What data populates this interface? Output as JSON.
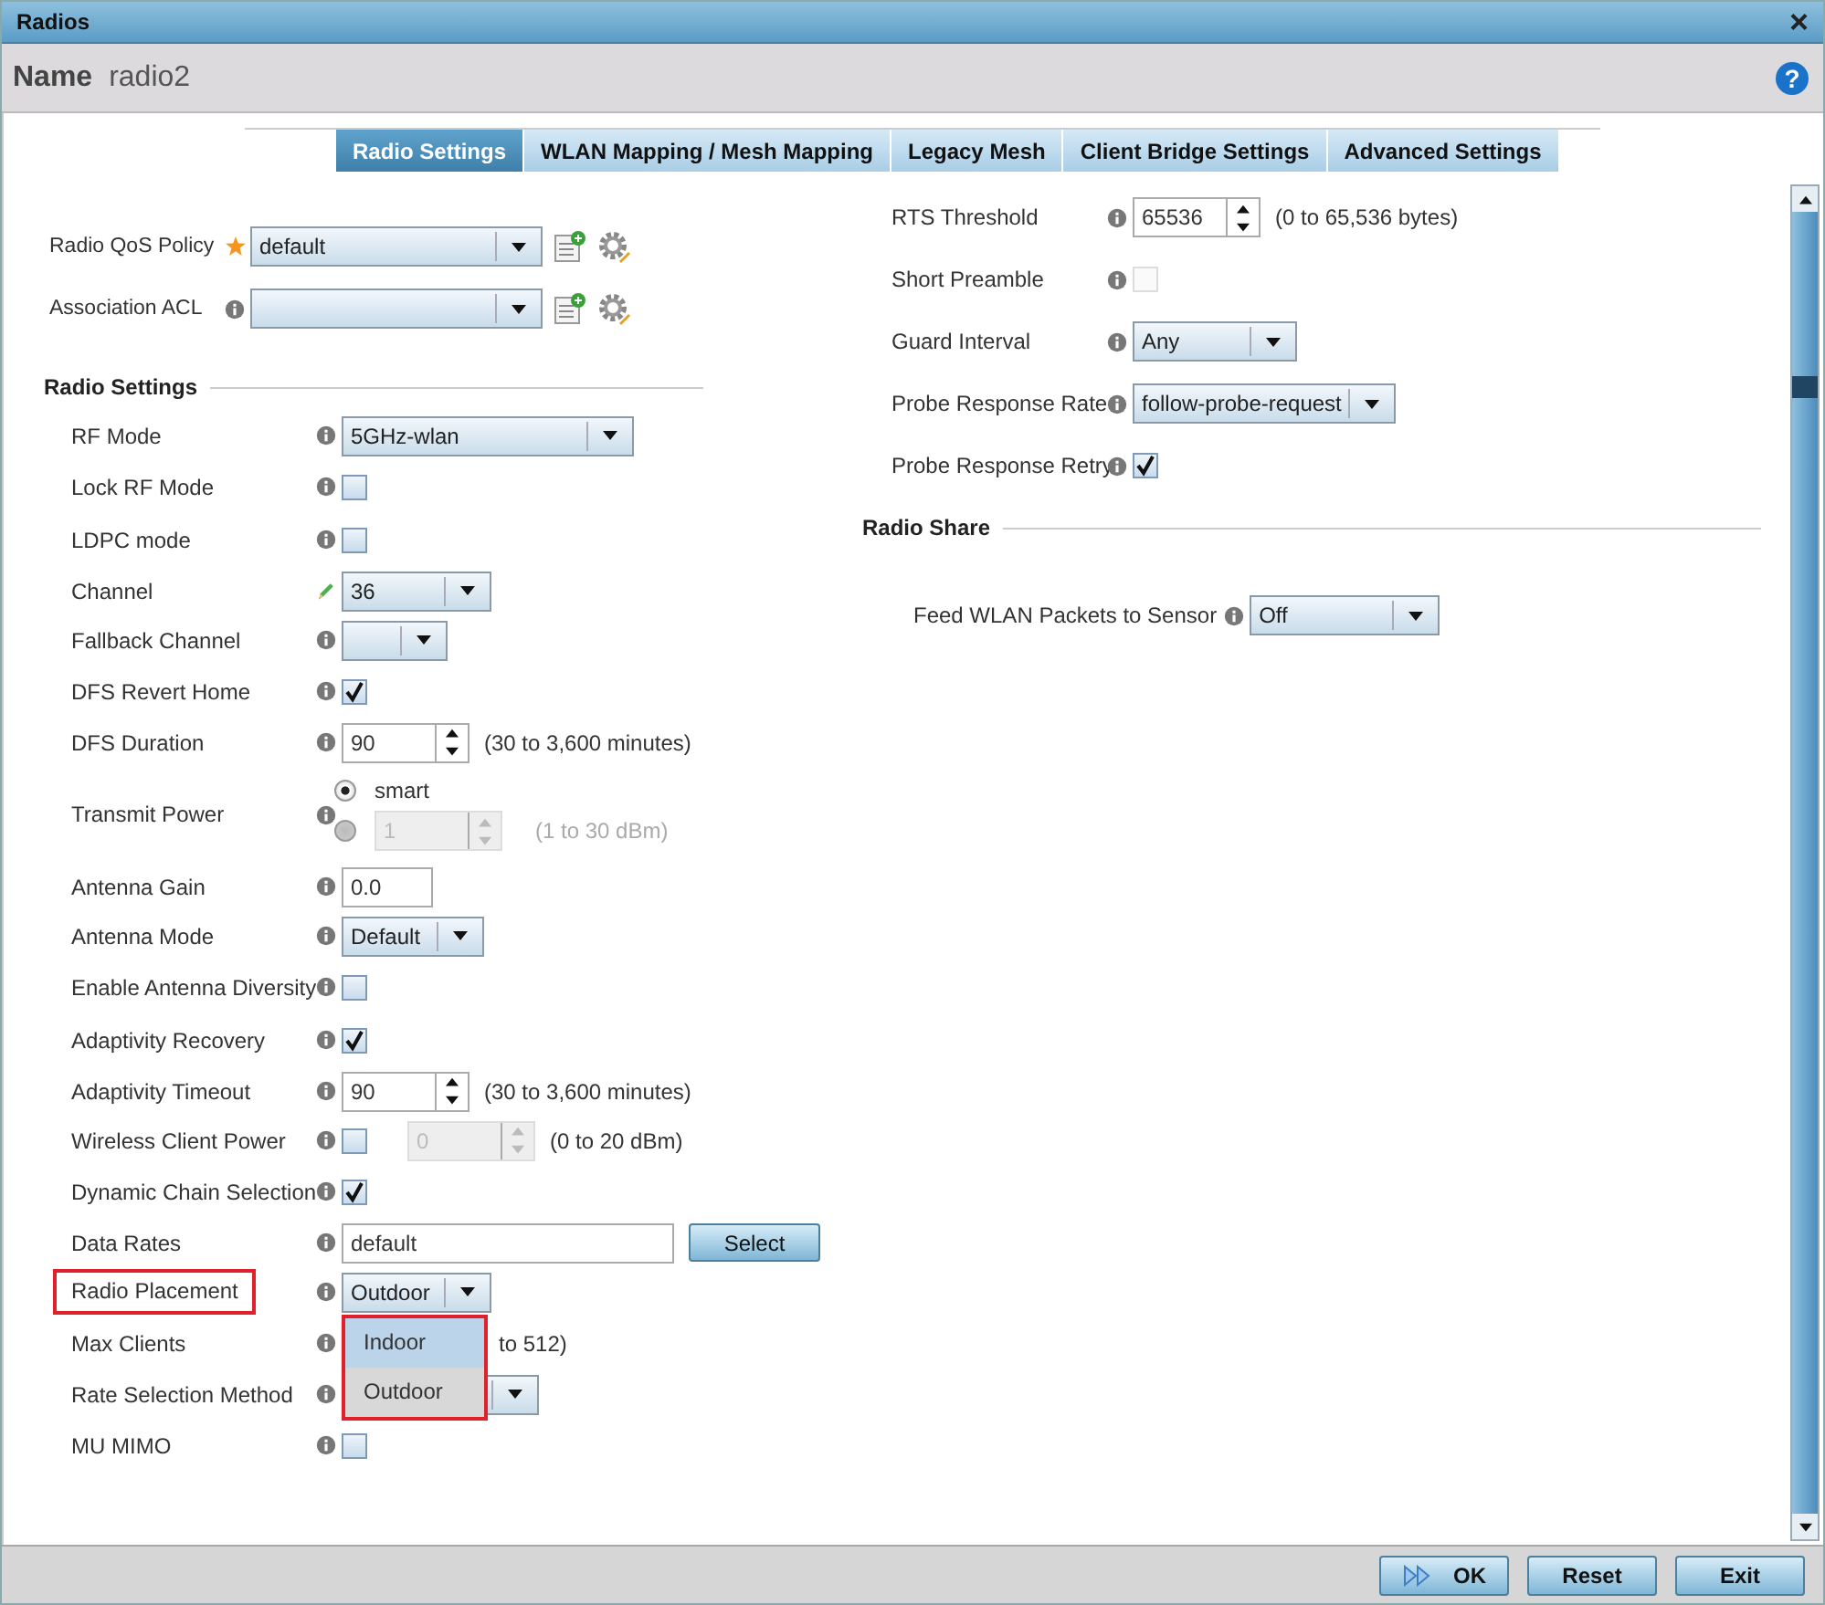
{
  "window": {
    "title": "Radios",
    "close": "×"
  },
  "name_bar": {
    "label": "Name",
    "value": "radio2",
    "help": "?"
  },
  "tabs": [
    {
      "label": "Radio Settings",
      "selected": true
    },
    {
      "label": "WLAN Mapping / Mesh Mapping",
      "selected": false
    },
    {
      "label": "Legacy Mesh",
      "selected": false
    },
    {
      "label": "Client Bridge Settings",
      "selected": false
    },
    {
      "label": "Advanced Settings",
      "selected": false
    }
  ],
  "policies": [
    {
      "label": "Radio QoS Policy",
      "kind": "required",
      "value": "default"
    },
    {
      "label": "Association ACL",
      "kind": "info"
    }
  ],
  "radio_settings": {
    "title": "Radio Settings",
    "rows": [
      {
        "kind": "select",
        "label": "RF Mode",
        "value": "5GHz-wlan"
      },
      {
        "kind": "checkbox",
        "label": "Lock RF Mode",
        "checked": false
      },
      {
        "kind": "checkbox",
        "label": "LDPC mode",
        "checked": false
      },
      {
        "kind": "select",
        "label": "Channel",
        "value": "36",
        "edited": true
      },
      {
        "kind": "select",
        "label": "Fallback Channel"
      },
      {
        "kind": "checkbox",
        "label": "DFS Revert Home",
        "checked": true
      },
      {
        "kind": "spinner",
        "label": "DFS Duration",
        "value": "90",
        "hint": "(30 to 3,600 minutes)"
      },
      {
        "kind": "power",
        "label": "Transmit Power",
        "option": "smart",
        "smart_selected": true,
        "value": "1",
        "hint": "(1 to 30 dBm)"
      },
      {
        "kind": "text",
        "label": "Antenna Gain",
        "value": "0.0"
      },
      {
        "kind": "select",
        "label": "Antenna Mode",
        "value": "Default"
      },
      {
        "kind": "checkbox",
        "label": "Enable Antenna Diversity",
        "checked": false
      },
      {
        "kind": "checkbox",
        "label": "Adaptivity Recovery",
        "checked": true
      },
      {
        "kind": "spinner",
        "label": "Adaptivity Timeout",
        "value": "90",
        "hint": "(30 to 3,600 minutes)"
      },
      {
        "kind": "check-spinner",
        "label": "Wireless Client Power",
        "checked": false,
        "value": "0",
        "hint": "(0 to 20 dBm)"
      },
      {
        "kind": "checkbox",
        "label": "Dynamic Chain Selection",
        "checked": true
      },
      {
        "kind": "text-button",
        "label": "Data Rates",
        "value": "default",
        "button": "Select"
      },
      {
        "kind": "dropdown-open",
        "label": "Radio Placement",
        "value": "Outdoor",
        "highlighted": true,
        "menu": {
          "highlighted": true,
          "options": [
            {
              "label": "Indoor",
              "selected": true
            },
            {
              "label": "Outdoor",
              "selected": false
            }
          ]
        }
      },
      {
        "kind": "covered",
        "label": "Max Clients",
        "hint": "to 512)"
      },
      {
        "kind": "select",
        "label": "Rate Selection Method"
      },
      {
        "kind": "checkbox",
        "label": "MU MIMO",
        "checked": false
      }
    ]
  },
  "right_rows": [
    {
      "kind": "spinner",
      "label": "RTS Threshold",
      "value": "65536",
      "hint": "(0 to 65,536 bytes)"
    },
    {
      "kind": "checkbox",
      "label": "Short Preamble",
      "checked": false,
      "disabled": true
    },
    {
      "kind": "select",
      "label": "Guard Interval",
      "value": "Any"
    },
    {
      "kind": "select",
      "label": "Probe Response Rate",
      "value": "follow-probe-request"
    },
    {
      "kind": "checkbox",
      "label": "Probe Response Retry",
      "checked": true
    }
  ],
  "radio_share": {
    "title": "Radio Share",
    "label": "Feed WLAN Packets to Sensor",
    "value": "Off"
  },
  "buttons": [
    {
      "label": "OK",
      "kind": "primary"
    },
    {
      "label": "Reset",
      "kind": "normal"
    },
    {
      "label": "Exit",
      "kind": "normal"
    }
  ]
}
